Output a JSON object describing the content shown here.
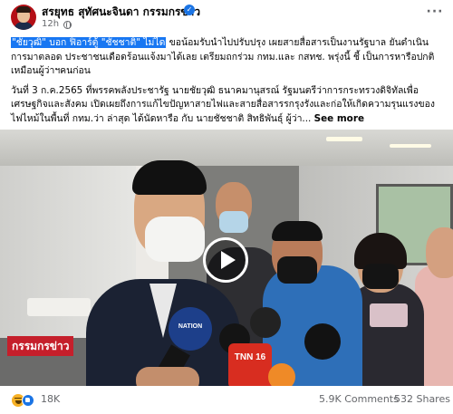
{
  "post": {
    "page_name": "สรยุทธ สุทัศนะจินดา กรรมกรข่าว",
    "time": "12h",
    "verified_mark": "✓",
    "more_icon": "more-horizontal-icon",
    "caption": {
      "highlight_1": "\"ชัยวุฒิ\" บอก ฟิอาร์ตู้ \"ชัชชาติ\" ไม่ได",
      "line_1_rest": " ขอน้อมรับนำไปปรับปรุง เผยสายสื่อสารเป็นงานรัฐบาล ยันดำเนินการมาตลอด ประชาชนเดือดร้อนแจ้งมาได้เลย เตรียมถกร่วม กทม.และ กสทช. พรุ่งนี้ ชี้ เป็นการหารือปกติ เหมือนผู้ว่าฯคนก่อน",
      "paragraph_2": "วันที่ 3 ก.ค.2565 ที่พรรคพลังประชารัฐ นายชัยวุฒิ ธนาคมานุสรณ์ รัฐมนตรีว่าการกระทรวงดิจิทัลเพื่อเศรษฐกิจและสังคม  เปิดเผยถึงการแก้ไขปัญหาสายไฟและสายสื่อสารรกรุงรังและก่อให้เกิดความรุนแรงของไฟไหม้ในพื้นที่ กทม.ว่า ล่าสุด ได้นัดหารือ กับ นายชัชชาติ สิทธิพันธุ์ ผู้ว่า...",
      "see_more": "See more"
    },
    "video": {
      "watermark": "กรรมกรข่าว",
      "mic_nation_label": "NATION",
      "mic_channel_label": "TNN 16"
    },
    "stats": {
      "reactions": "18K",
      "comments": "5.9K Comments",
      "shares": "532 Shares"
    },
    "colors": {
      "highlight": "#1877f2",
      "verified": "#1b74e4",
      "watermark": "#c51f2b"
    }
  }
}
